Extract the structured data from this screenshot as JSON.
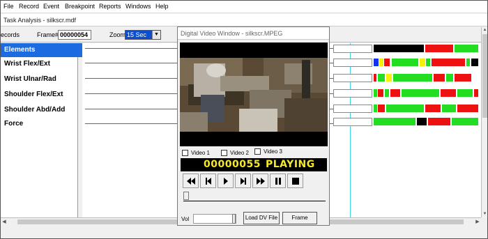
{
  "menu": [
    "File",
    "Record",
    "Event",
    "Breakpoint",
    "Reports",
    "Windows",
    "Help"
  ],
  "window_title": "Task Analysis - silkscr.mdf",
  "toolbar": {
    "records_label": "ecords",
    "frame_label": "Frame#:",
    "frame_value": "00000054",
    "zoom_label": "Zoom",
    "zoom_value": "15 Sec"
  },
  "elements": {
    "header": "Elements",
    "rows": [
      "Wrist Flex/Ext",
      "Wrist Ulnar/Rad",
      "Shoulder Flex/Ext",
      "Shoulder Abd/Add",
      "Force"
    ]
  },
  "colors": {
    "green": "#22dd22",
    "red": "#ee1111",
    "black": "#000000",
    "yellow": "#f4f20a",
    "blue": "#1133ee",
    "selection": "#1c6be0",
    "cursor_line": "#3ad6e6"
  },
  "dv_window": {
    "title": "Digital Video Window - silkscr.MPEG",
    "checkboxes": [
      "Video 1",
      "Video 2",
      "Video 3"
    ],
    "frame_display": "00000055",
    "status_display": "PLAYING",
    "volume_label": "Vol",
    "load_button": "Load DV File",
    "frame_button": "Frame"
  }
}
